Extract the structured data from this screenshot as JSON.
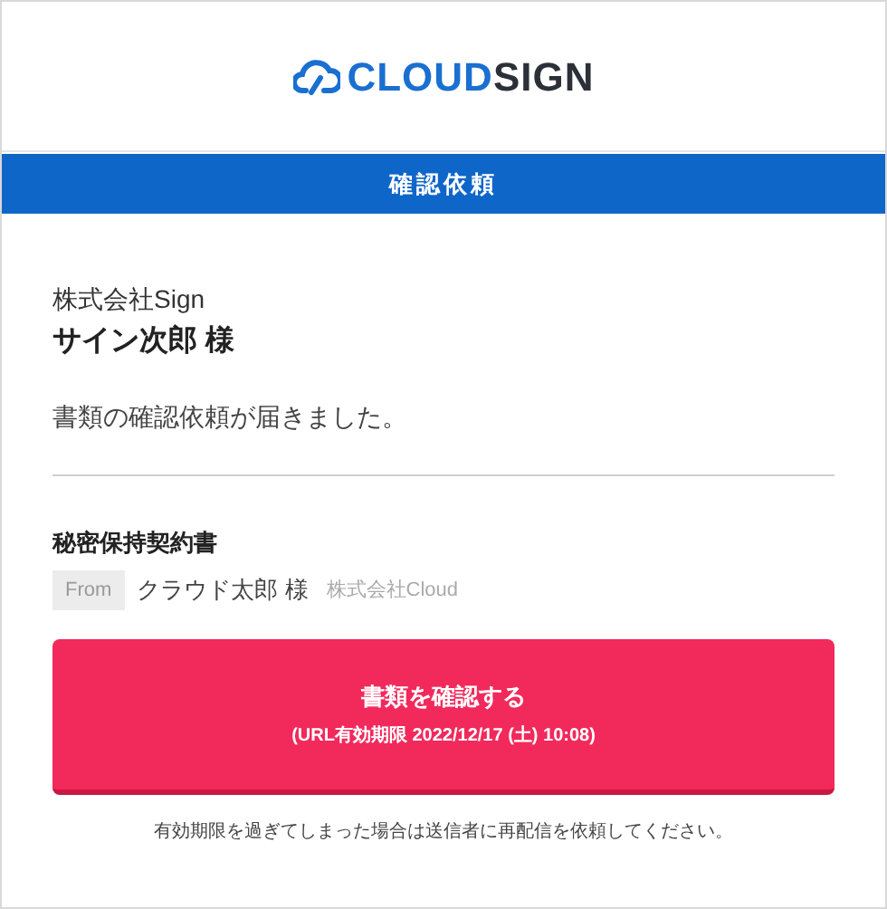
{
  "logo": {
    "part_1": "CLOUD",
    "part_2": "SIGN"
  },
  "banner": {
    "title": "確認依頼"
  },
  "recipient": {
    "company": "株式会社Sign",
    "name": "サイン次郎 様"
  },
  "message": "書類の確認依頼が届きました。",
  "document": {
    "title": "秘密保持契約書",
    "from_label": "From",
    "sender_name": "クラウド太郎 様",
    "sender_company": "株式会社Cloud"
  },
  "button": {
    "label": "書類を確認する",
    "sublabel": "(URL有効期限 2022/12/17 (土) 10:08)"
  },
  "note": "有効期限を過ぎてしまった場合は送信者に再配信を依頼してください。"
}
